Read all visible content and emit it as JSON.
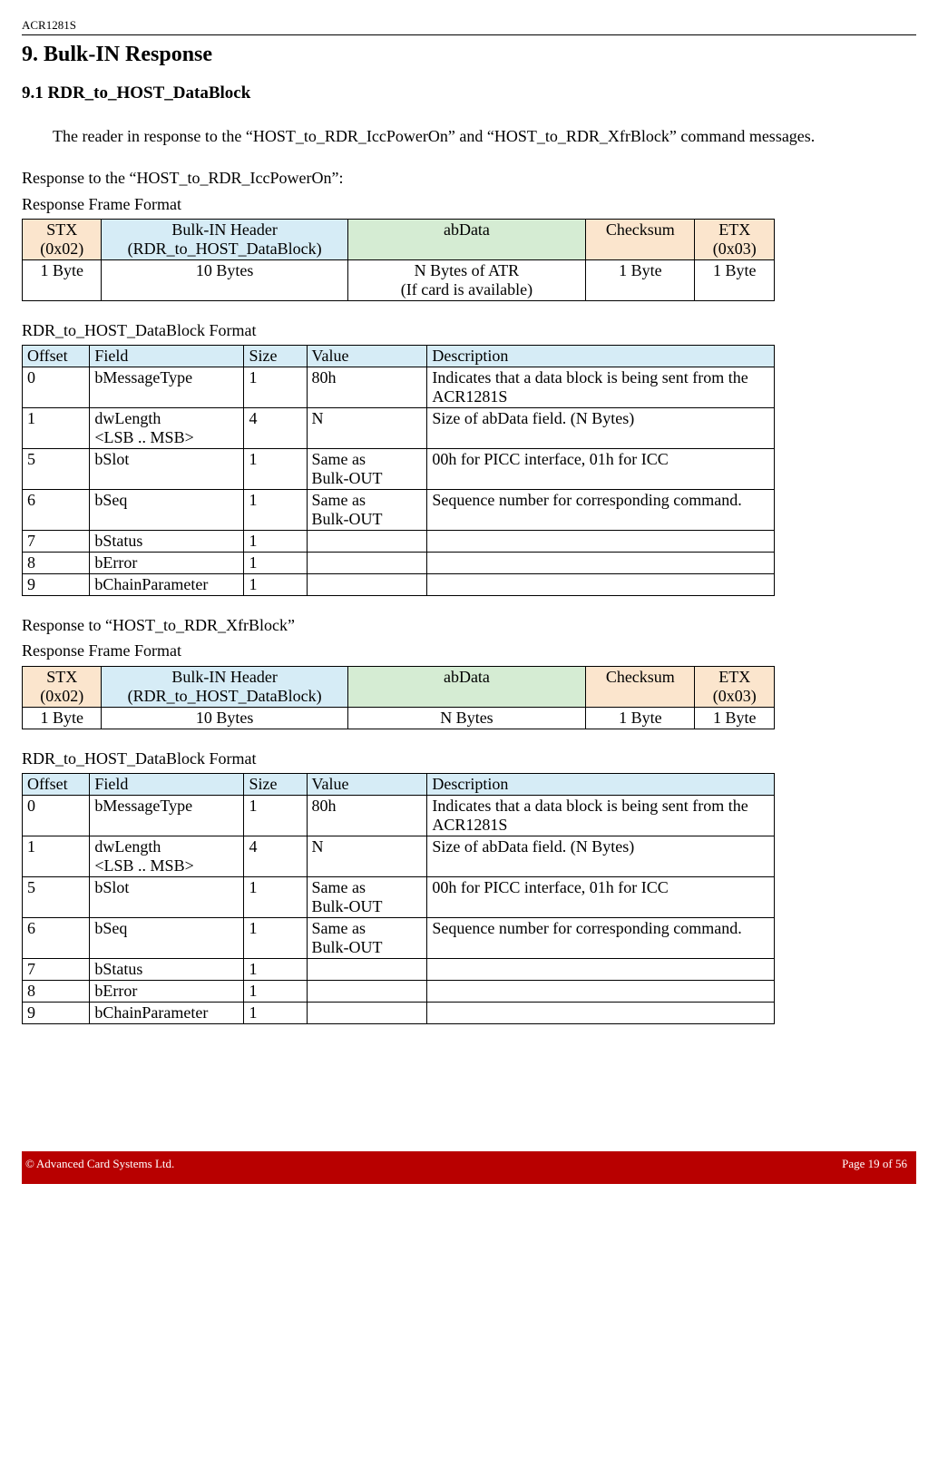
{
  "header": {
    "doc_code": "ACR1281S"
  },
  "titles": {
    "h1": "9.  Bulk-IN Response",
    "h2": "9.1 RDR_to_HOST_DataBlock"
  },
  "paragraphs": {
    "intro": "The reader in response to the “HOST_to_RDR_IccPowerOn” and “HOST_to_RDR_XfrBlock” command messages.",
    "resp1": "Response to the “HOST_to_RDR_IccPowerOn”:",
    "frameFmt": "Response Frame Format",
    "rdrFmt": "RDR_to_HOST_DataBlock Format",
    "resp2": "Response to “HOST_to_RDR_XfrBlock”"
  },
  "frame1": {
    "h": {
      "c0a": "STX",
      "c0b": "(0x02)",
      "c1a": "Bulk-IN Header",
      "c1b": "(RDR_to_HOST_DataBlock)",
      "c2": "abData",
      "c3": "Checksum",
      "c4a": "ETX",
      "c4b": "(0x03)"
    },
    "b": {
      "c0": "1 Byte",
      "c1": "10 Bytes",
      "c2a": "N Bytes of ATR",
      "c2b": "(If card is available)",
      "c3": "1 Byte",
      "c4": "1 Byte"
    }
  },
  "fmt1": {
    "hdr": {
      "c0": "Offset",
      "c1": "Field",
      "c2": "Size",
      "c3": "Value",
      "c4": "Description"
    },
    "r0": {
      "c0": "0",
      "c1": "bMessageType",
      "c2": "1",
      "c3": "80h",
      "c4": "Indicates that a data block is being sent from the ACR1281S"
    },
    "r1": {
      "c0": "1",
      "c1a": "dwLength",
      "c1b": "<LSB .. MSB>",
      "c2": "4",
      "c3": "N",
      "c4": "Size of abData field. (N Bytes)"
    },
    "r2": {
      "c0": "5",
      "c1": "bSlot",
      "c2": "1",
      "c3a": "Same as",
      "c3b": "Bulk-OUT",
      "c4": "00h for PICC interface, 01h for ICC"
    },
    "r3": {
      "c0": "6",
      "c1": "bSeq",
      "c2": "1",
      "c3a": "Same as",
      "c3b": "Bulk-OUT",
      "c4": "Sequence number for corresponding command."
    },
    "r4": {
      "c0": "7",
      "c1": "bStatus",
      "c2": "1",
      "c3": "",
      "c4": ""
    },
    "r5": {
      "c0": "8",
      "c1": "bError",
      "c2": "1",
      "c3": "",
      "c4": ""
    },
    "r6": {
      "c0": "9",
      "c1": "bChainParameter",
      "c2": "1",
      "c3": "",
      "c4": ""
    }
  },
  "frame2": {
    "h": {
      "c0a": "STX",
      "c0b": "(0x02)",
      "c1a": "Bulk-IN Header",
      "c1b": "(RDR_to_HOST_DataBlock)",
      "c2": "abData",
      "c3": "Checksum",
      "c4a": "ETX",
      "c4b": "(0x03)"
    },
    "b": {
      "c0": "1 Byte",
      "c1": "10 Bytes",
      "c2": "N Bytes",
      "c3": "1 Byte",
      "c4": "1 Byte"
    }
  },
  "fmt2": {
    "hdr": {
      "c0": "Offset",
      "c1": "Field",
      "c2": "Size",
      "c3": "Value",
      "c4": "Description"
    },
    "r0": {
      "c0": "0",
      "c1": "bMessageType",
      "c2": "1",
      "c3": "80h",
      "c4": "Indicates that a data block is being sent from the ACR1281S"
    },
    "r1": {
      "c0": "1",
      "c1a": "dwLength",
      "c1b": "<LSB .. MSB>",
      "c2": "4",
      "c3": "N",
      "c4": "Size of abData field. (N Bytes)"
    },
    "r2": {
      "c0": "5",
      "c1": "bSlot",
      "c2": "1",
      "c3a": "Same as",
      "c3b": "Bulk-OUT",
      "c4": "00h for PICC interface, 01h for ICC"
    },
    "r3": {
      "c0": "6",
      "c1": "bSeq",
      "c2": "1",
      "c3a": "Same as",
      "c3b": "Bulk-OUT",
      "c4": "Sequence number for corresponding command."
    },
    "r4": {
      "c0": "7",
      "c1": "bStatus",
      "c2": "1",
      "c3": "",
      "c4": ""
    },
    "r5": {
      "c0": "8",
      "c1": "bError",
      "c2": "1",
      "c3": "",
      "c4": ""
    },
    "r6": {
      "c0": "9",
      "c1": "bChainParameter",
      "c2": "1",
      "c3": "",
      "c4": ""
    }
  },
  "footer": {
    "copyright_symbol": "©",
    "copyright_text": " Advanced Card Systems Ltd.",
    "page": "Page 19 of 56"
  }
}
